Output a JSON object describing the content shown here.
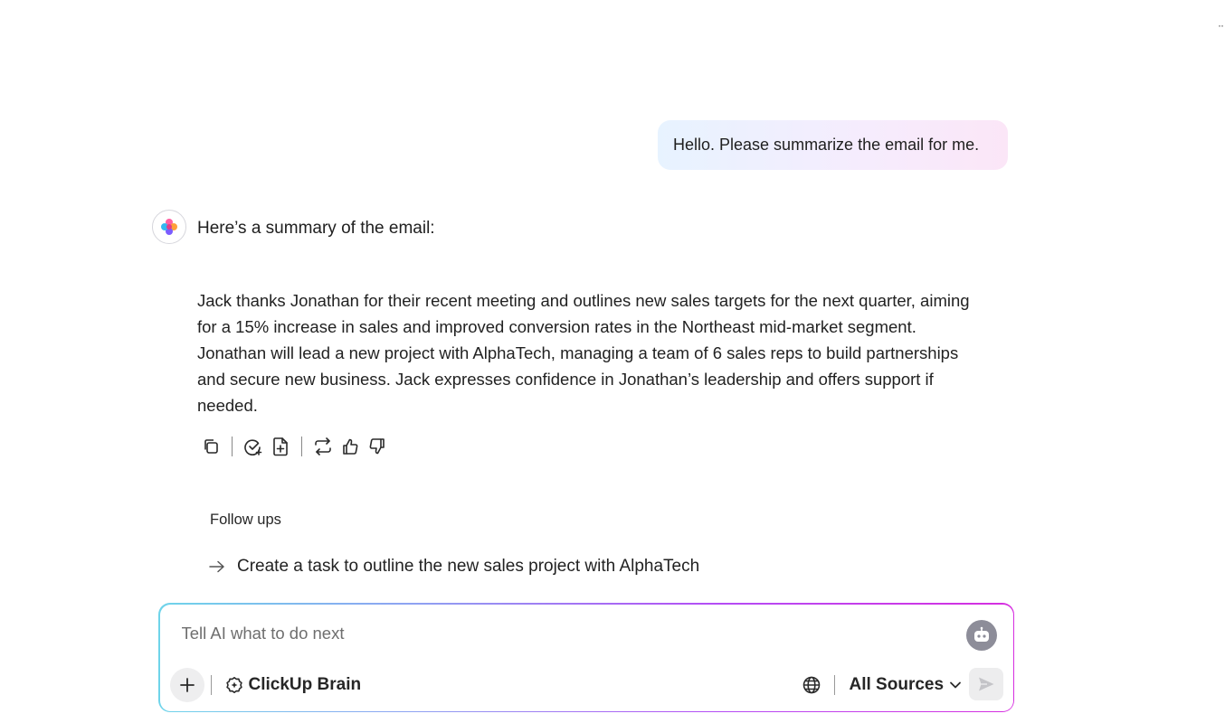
{
  "conversation": {
    "user_message": "Hello. Please summarize the email for me.",
    "assistant": {
      "avatar_icon": "clickup-brain-logo-icon",
      "intro": "Here’s a summary of the email:",
      "body": "Jack thanks Jonathan for their recent meeting and outlines new sales targets for the next quarter, aiming for a 15% increase in sales and improved conversion rates in the Northeast mid-market segment. Jonathan will lead a new project with AlphaTech, managing a team of 6 sales reps to build partnerships and secure new business. Jack expresses confidence in Jonathan’s leadership and offers support if needed.",
      "actions": [
        {
          "name": "copy",
          "icon": "copy-icon"
        },
        {
          "name": "create-task",
          "icon": "task-check-plus-icon"
        },
        {
          "name": "create-doc",
          "icon": "doc-plus-icon"
        },
        {
          "name": "regenerate",
          "icon": "regenerate-icon"
        },
        {
          "name": "like",
          "icon": "thumbs-up-icon"
        },
        {
          "name": "dislike",
          "icon": "thumbs-down-icon"
        }
      ]
    },
    "followups": {
      "title": "Follow ups",
      "items": [
        {
          "label": "Create a task to outline the new sales project with AlphaTech",
          "icon": "arrow-right-icon"
        }
      ]
    }
  },
  "composer": {
    "placeholder": "Tell AI what to do next",
    "value": "",
    "add_icon": "plus-icon",
    "agent_icon": "robot-icon",
    "brain_label": "ClickUp Brain",
    "brain_icon": "brain-icon",
    "globe_icon": "globe-icon",
    "sources_label": "All Sources",
    "sources_icon": "chevron-down-icon",
    "send_icon": "send-icon"
  },
  "colors": {
    "user_bubble_start": "#e7f3ff",
    "user_bubble_end": "#fbe6f7",
    "composer_gradient_start": "#6fd4ea",
    "composer_gradient_end": "#d62ee0"
  }
}
